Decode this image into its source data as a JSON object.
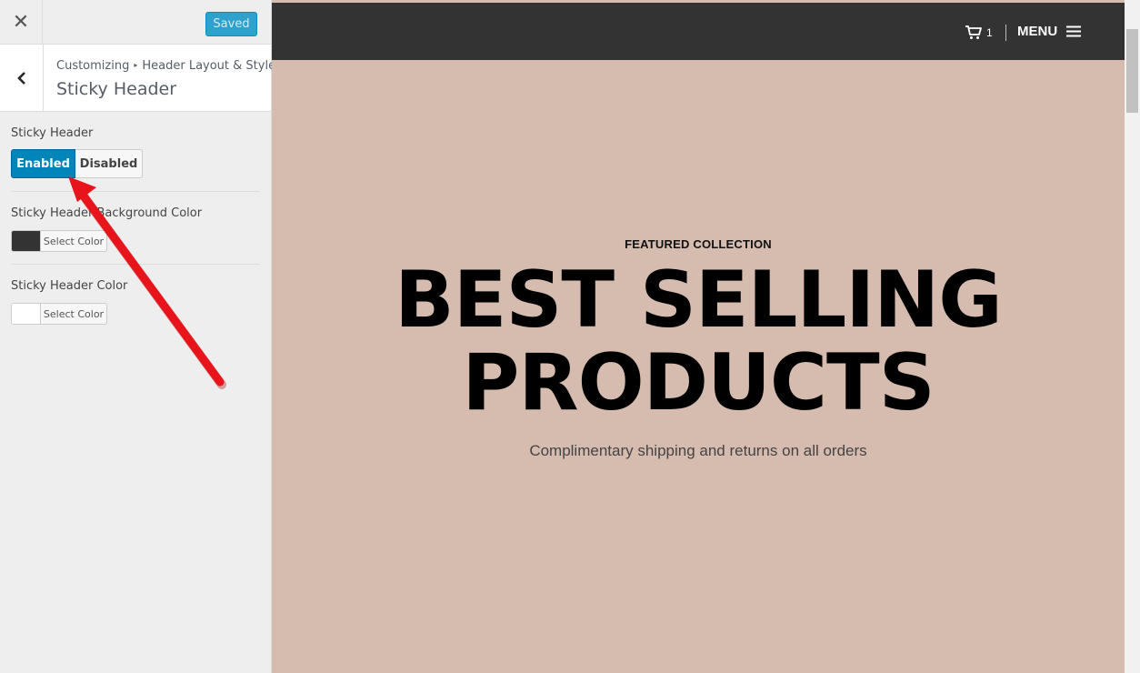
{
  "topbar": {
    "close_icon": "close-icon",
    "saved_label": "Saved"
  },
  "section": {
    "breadcrumb": [
      "Customizing",
      "Header Layout & Style"
    ],
    "breadcrumb_separator": "▸",
    "title": "Sticky Header"
  },
  "controls": {
    "sticky_header": {
      "label": "Sticky Header",
      "options": [
        "Enabled",
        "Disabled"
      ],
      "selected": "Enabled"
    },
    "bg_color": {
      "label": "Sticky Header Background Color",
      "button_text": "Select Color",
      "swatch": "#333333"
    },
    "text_color": {
      "label": "Sticky Header Color",
      "button_text": "Select Color",
      "swatch": "#ffffff"
    }
  },
  "preview": {
    "header_bg": "#333333",
    "page_bg": "#d6bcae",
    "cart_count": "1",
    "menu_label": "MENU",
    "eyebrow": "FEATURED COLLECTION",
    "headline": "BEST SELLING\nPRODUCTS",
    "subline": "Complimentary shipping and returns on all orders"
  },
  "annotation": {
    "arrow_color": "#e8141b"
  }
}
